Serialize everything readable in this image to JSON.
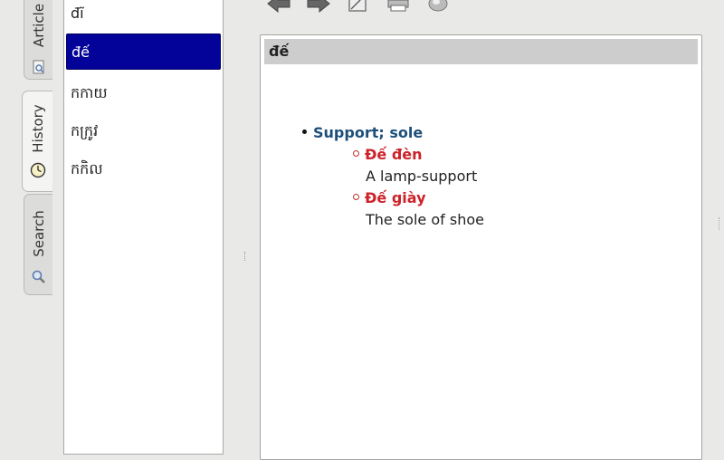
{
  "tabs": [
    {
      "label": "Article",
      "icon": "article-icon"
    },
    {
      "label": "History",
      "icon": "clock-icon"
    },
    {
      "label": "Search",
      "icon": "magnifier-icon"
    }
  ],
  "wordlist": {
    "items": [
      "đĩ",
      "đế",
      "កកាយ",
      "កក្រូវ",
      "កកិល"
    ],
    "selected_index": 1
  },
  "toolbar": {
    "buttons": [
      "back-arrow-icon",
      "forward-arrow-icon",
      "edit-icon",
      "print-icon",
      "speaker-icon"
    ]
  },
  "article": {
    "headword": "đế",
    "sense": "Support; sole",
    "examples": [
      {
        "word": "Đế đèn",
        "translation": "A lamp-support"
      },
      {
        "word": "Đế giày",
        "translation": "The sole of shoe"
      }
    ]
  },
  "colors": {
    "selection": "#03039a",
    "sense": "#1d4f7a",
    "example_word": "#cc2229"
  }
}
